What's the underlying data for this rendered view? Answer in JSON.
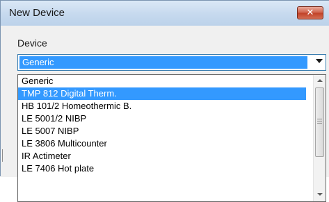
{
  "window": {
    "title": "New Device",
    "close_glyph": "✕"
  },
  "device_field": {
    "label": "Device",
    "selected_value": "Generic"
  },
  "dropdown": {
    "options": [
      "Generic",
      "TMP 812 Digital Therm.",
      "HB 101/2 Homeothermic B.",
      "LE 5001/2 NIBP",
      "LE 5007 NIBP",
      "LE 3806 Multicounter",
      "IR Actimeter",
      "LE 7406 Hot plate"
    ],
    "highlighted_index": 1
  },
  "colors": {
    "selection": "#3399ff",
    "titlebar": "#c6d9ee",
    "close_button": "#c94a32"
  }
}
